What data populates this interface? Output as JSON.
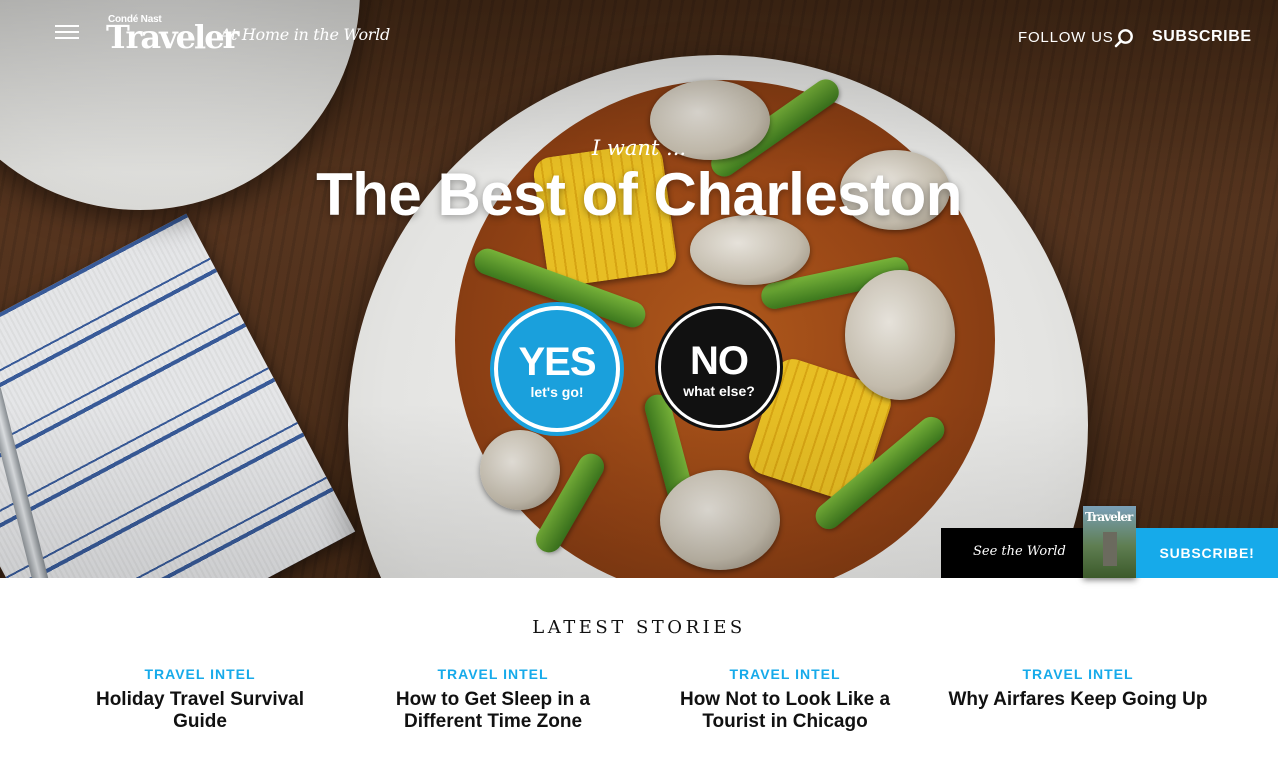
{
  "header": {
    "logo_small": "Condé Nast",
    "logo_big": "Traveler",
    "tagline": "At Home in the World",
    "follow_us": "FOLLOW US",
    "subscribe": "SUBSCRIBE"
  },
  "hero": {
    "eyebrow": "I want ...",
    "title": "The Best of Charleston",
    "yes": {
      "main": "YES",
      "sub": "let's go!"
    },
    "no": {
      "main": "NO",
      "sub": "what else?"
    }
  },
  "subscribe_bar": {
    "tagline": "See the World",
    "magazine_title": "Traveler",
    "button": "SUBSCRIBE!"
  },
  "latest": {
    "heading": "LATEST STORIES",
    "stories": [
      {
        "category": "TRAVEL INTEL",
        "title": "Holiday Travel Survival Guide"
      },
      {
        "category": "TRAVEL INTEL",
        "title": "How to Get Sleep in a Different Time Zone"
      },
      {
        "category": "TRAVEL INTEL",
        "title": "How Not to Look Like a Tourist in Chicago"
      },
      {
        "category": "TRAVEL INTEL",
        "title": "Why Airfares Keep Going Up"
      }
    ]
  },
  "colors": {
    "accent_blue": "#16aaea",
    "yes_button": "#1aa0dc",
    "no_button": "#111111"
  },
  "icons": [
    "hamburger-menu-icon",
    "search-icon"
  ]
}
